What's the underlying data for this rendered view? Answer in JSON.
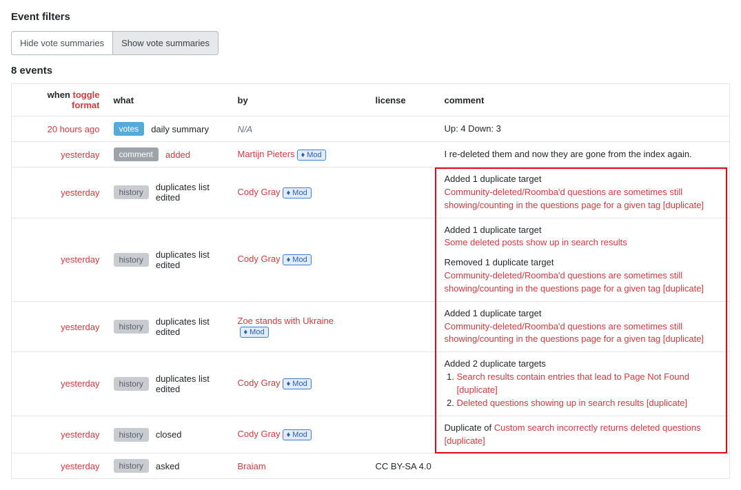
{
  "headings": {
    "filters": "Event filters",
    "count": "8 events"
  },
  "filters": {
    "hide": "Hide vote summaries",
    "show": "Show vote summaries"
  },
  "columns": {
    "when": "when",
    "toggle": "toggle format",
    "what": "what",
    "by": "by",
    "license": "license",
    "comment": "comment"
  },
  "badges": {
    "votes": "votes",
    "comment": "comment",
    "history": "history",
    "mod": "♦ Mod"
  },
  "rows": [
    {
      "when": "20 hours ago",
      "badge": "votes",
      "action": "daily summary",
      "by_italic": "N/A",
      "comment_plain": "Up: 4    Down: 3"
    },
    {
      "when": "yesterday",
      "badge": "comment",
      "action": "added",
      "action_red": true,
      "by": "Martijn Pieters",
      "mod": true,
      "comment_plain": "I re-deleted them and now they are gone from the index again."
    },
    {
      "when": "yesterday",
      "badge": "history",
      "action": "duplicates list edited",
      "by": "Cody Gray",
      "mod": true,
      "blocks": [
        {
          "title": "Added 1 duplicate target",
          "links": [
            "Community-deleted/Roomba'd questions are sometimes still showing/counting in the questions page for a given tag [duplicate]"
          ]
        }
      ]
    },
    {
      "when": "yesterday",
      "badge": "history",
      "action": "duplicates list edited",
      "by": "Cody Gray",
      "mod": true,
      "blocks": [
        {
          "title": "Added 1 duplicate target",
          "links": [
            "Some deleted posts show up in search results"
          ]
        },
        {
          "title": "Removed 1 duplicate target",
          "links": [
            "Community-deleted/Roomba'd questions are sometimes still showing/counting in the questions page for a given tag [duplicate]"
          ]
        }
      ]
    },
    {
      "when": "yesterday",
      "badge": "history",
      "action": "duplicates list edited",
      "by": "Zoe stands with Ukraine",
      "mod": true,
      "blocks": [
        {
          "title": "Added 1 duplicate target",
          "links": [
            "Community-deleted/Roomba'd questions are sometimes still showing/counting in the questions page for a given tag [duplicate]"
          ]
        }
      ]
    },
    {
      "when": "yesterday",
      "badge": "history",
      "action": "duplicates list edited",
      "by": "Cody Gray",
      "mod": true,
      "blocks": [
        {
          "title": "Added 2 duplicate targets",
          "ordered": true,
          "links": [
            "Search results contain entries that lead to Page Not Found [duplicate]",
            "Deleted questions showing up in search results [duplicate]"
          ]
        }
      ]
    },
    {
      "when": "yesterday",
      "badge": "history",
      "action": "closed",
      "by": "Cody Gray",
      "mod": true,
      "dup_prefix": "Duplicate of ",
      "dup_link": "Custom search incorrectly returns deleted questions [duplicate]"
    },
    {
      "when": "yesterday",
      "badge": "history",
      "action": "asked",
      "by": "Braiam",
      "license": "CC BY-SA 4.0"
    }
  ]
}
